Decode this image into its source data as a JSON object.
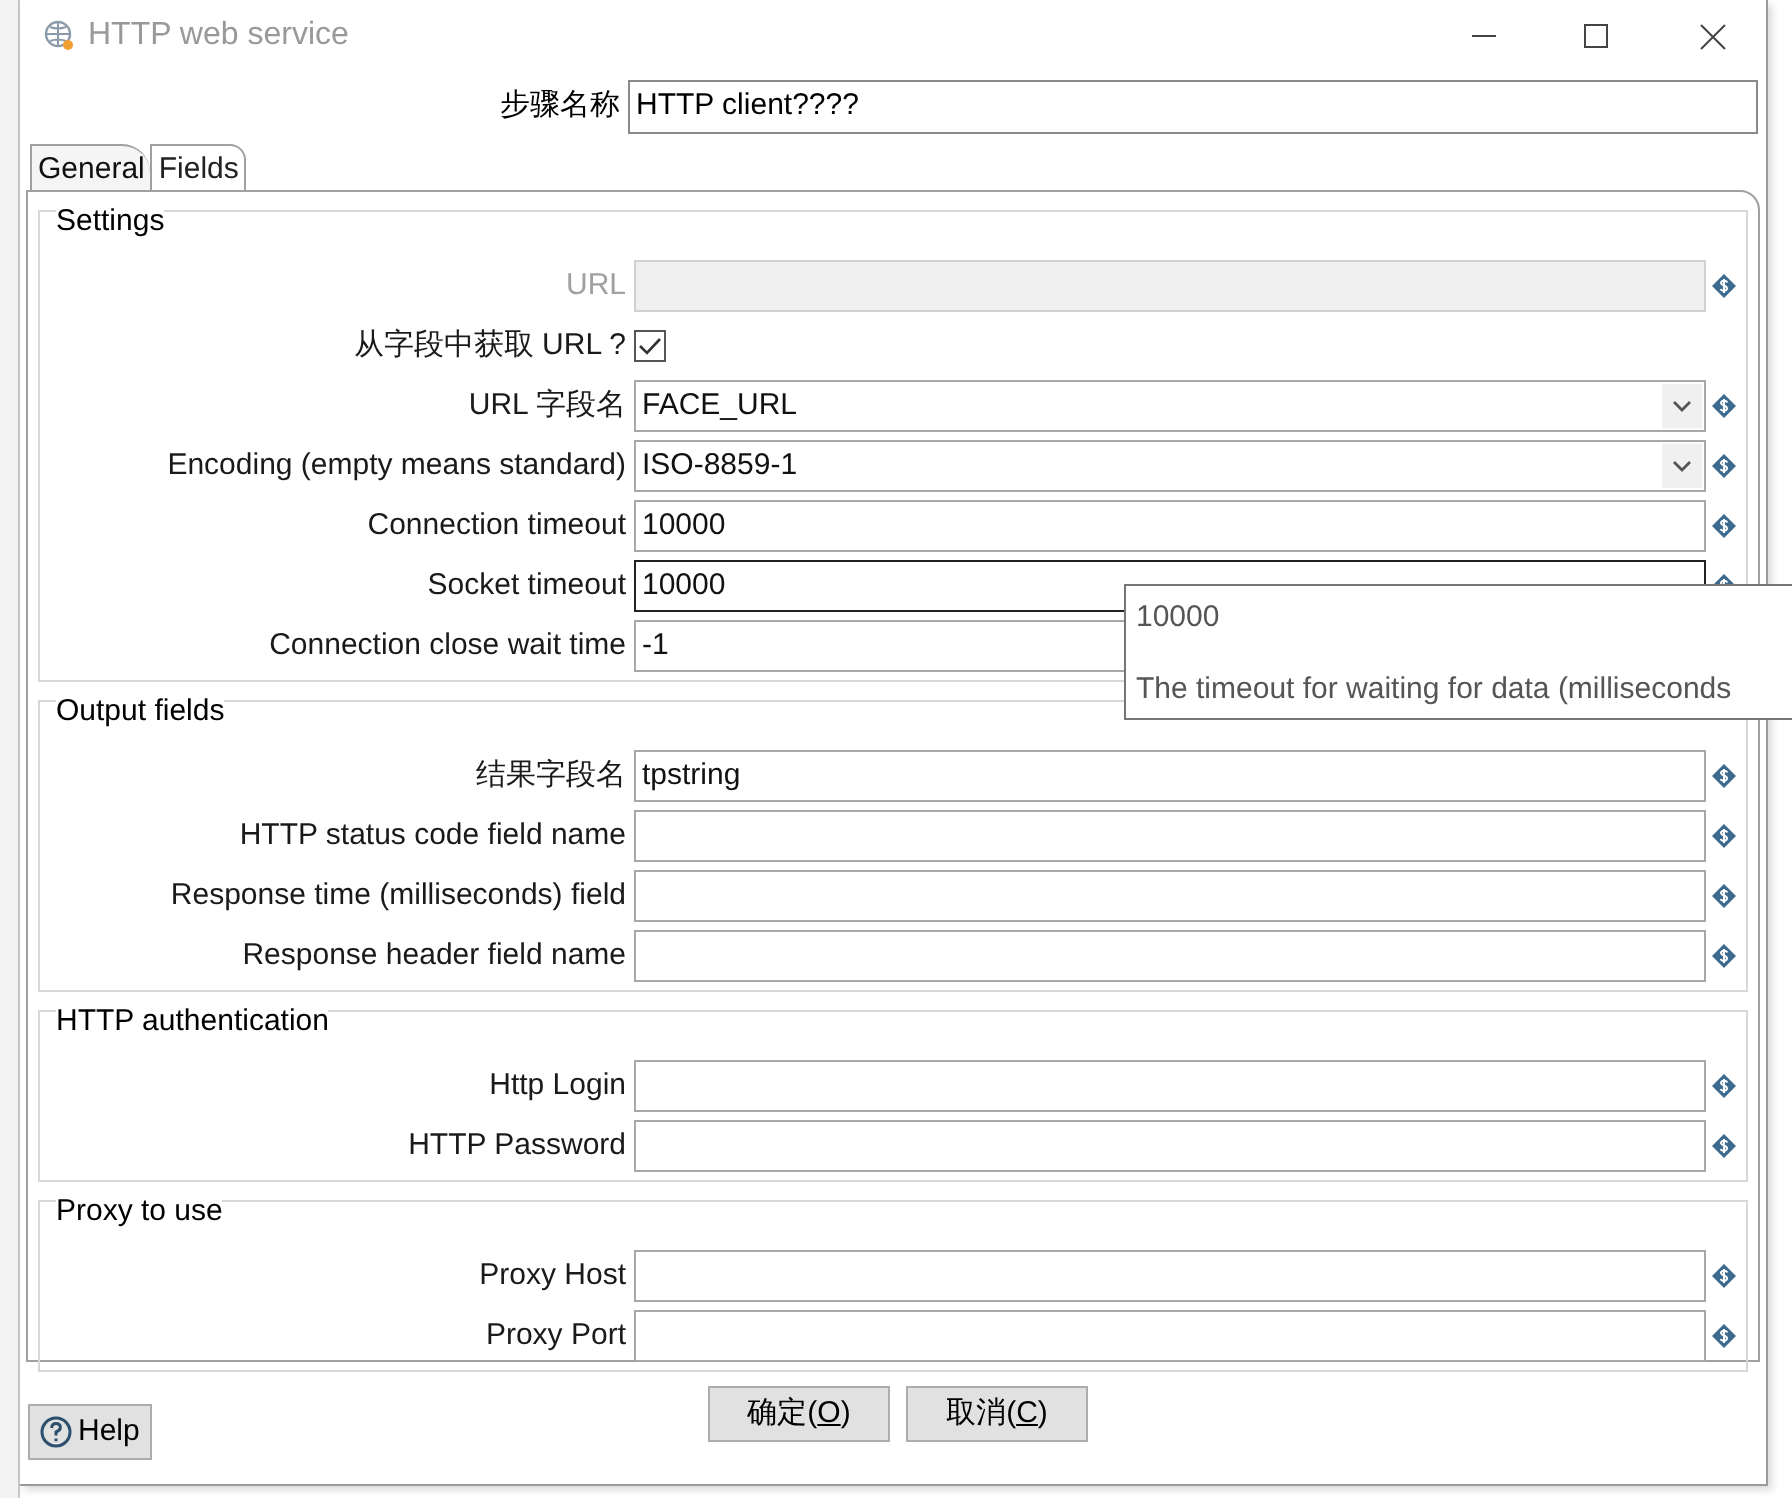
{
  "window": {
    "title": "HTTP web service"
  },
  "step_name": {
    "label": "步骤名称",
    "value": "HTTP client????"
  },
  "tabs": [
    {
      "label": "General",
      "selected": true
    },
    {
      "label": "Fields",
      "selected": false
    }
  ],
  "groups": [
    {
      "title": "Settings",
      "rows": [
        {
          "kind": "text",
          "label": "URL",
          "value": "",
          "disabled": true,
          "focused": false
        },
        {
          "kind": "checkbox",
          "label": "从字段中获取 URL ?",
          "checked": true
        },
        {
          "kind": "combo",
          "label": "URL 字段名",
          "value": "FACE_URL",
          "disabled": false,
          "focused": false
        },
        {
          "kind": "combo",
          "label": "Encoding (empty means standard)",
          "value": "ISO-8859-1",
          "disabled": false,
          "focused": false
        },
        {
          "kind": "text",
          "label": "Connection timeout",
          "value": "10000",
          "disabled": false,
          "focused": false
        },
        {
          "kind": "text",
          "label": "Socket timeout",
          "value": "10000",
          "disabled": false,
          "focused": true
        },
        {
          "kind": "text",
          "label": "Connection close wait time",
          "value": "-1",
          "disabled": false,
          "focused": false
        }
      ]
    },
    {
      "title": "Output fields",
      "rows": [
        {
          "kind": "text",
          "label": "结果字段名",
          "value": "tpstring",
          "disabled": false,
          "focused": false
        },
        {
          "kind": "text",
          "label": "HTTP status code field name",
          "value": "",
          "disabled": false,
          "focused": false
        },
        {
          "kind": "text",
          "label": "Response time (milliseconds) field",
          "value": "",
          "disabled": false,
          "focused": false
        },
        {
          "kind": "text",
          "label": "Response header field name",
          "value": "",
          "disabled": false,
          "focused": false
        }
      ]
    },
    {
      "title": "HTTP authentication",
      "rows": [
        {
          "kind": "text",
          "label": "Http Login",
          "value": "",
          "disabled": false,
          "focused": false
        },
        {
          "kind": "text",
          "label": "HTTP Password",
          "value": "",
          "disabled": false,
          "focused": false
        }
      ]
    },
    {
      "title": "Proxy to use",
      "rows": [
        {
          "kind": "text",
          "label": "Proxy Host",
          "value": "",
          "disabled": false,
          "focused": false
        },
        {
          "kind": "text",
          "label": "Proxy Port",
          "value": "",
          "disabled": false,
          "focused": false
        }
      ]
    }
  ],
  "tooltip": {
    "value": "10000",
    "text": "The timeout for waiting for data (milliseconds"
  },
  "help_button": {
    "label": "Help"
  },
  "buttons": [
    {
      "before": "确定(",
      "mnemonic": "O",
      "after": ")"
    },
    {
      "before": "取消(",
      "mnemonic": "C",
      "after": ")"
    }
  ]
}
